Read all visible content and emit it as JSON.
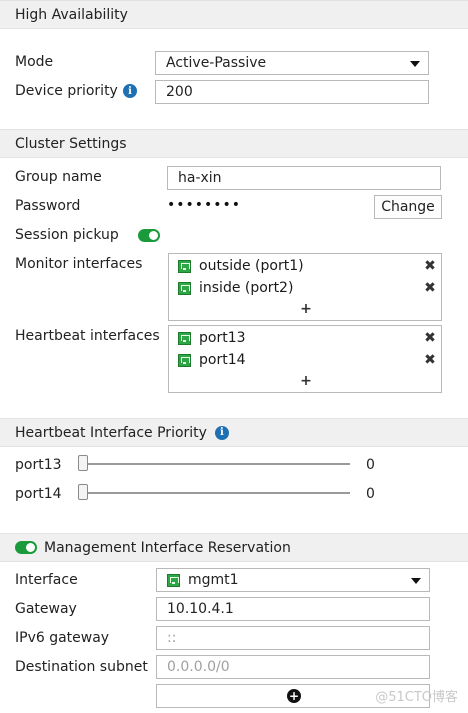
{
  "high_availability": {
    "header": "High Availability",
    "mode_label": "Mode",
    "mode_value": "Active-Passive",
    "priority_label": "Device priority",
    "priority_value": "200"
  },
  "cluster": {
    "header": "Cluster Settings",
    "group_name_label": "Group name",
    "group_name_value": "ha-xin",
    "password_label": "Password",
    "password_mask": "••••••••",
    "change_button": "Change",
    "session_pickup_label": "Session pickup",
    "session_pickup_enabled": true,
    "monitor_label": "Monitor interfaces",
    "monitor_interfaces": [
      "outside (port1)",
      "inside (port2)"
    ],
    "heartbeat_label": "Heartbeat interfaces",
    "heartbeat_interfaces": [
      "port13",
      "port14"
    ],
    "add_symbol": "+",
    "remove_symbol": "✖"
  },
  "hb_priority": {
    "header": "Heartbeat Interface Priority",
    "ports": [
      {
        "name": "port13",
        "value": "0"
      },
      {
        "name": "port14",
        "value": "0"
      }
    ]
  },
  "mgmt": {
    "header": "Management Interface Reservation",
    "enabled": true,
    "interface_label": "Interface",
    "interface_value": "mgmt1",
    "gateway_label": "Gateway",
    "gateway_value": "10.10.4.1",
    "ipv6_label": "IPv6 gateway",
    "ipv6_placeholder": "::",
    "dest_label": "Destination subnet",
    "dest_placeholder": "0.0.0.0/0"
  },
  "colors": {
    "toggle_on": "#1a9a3a",
    "info_icon": "#1f6fb3",
    "port_icon": "#2da646"
  },
  "watermark": "@51CTO博客"
}
